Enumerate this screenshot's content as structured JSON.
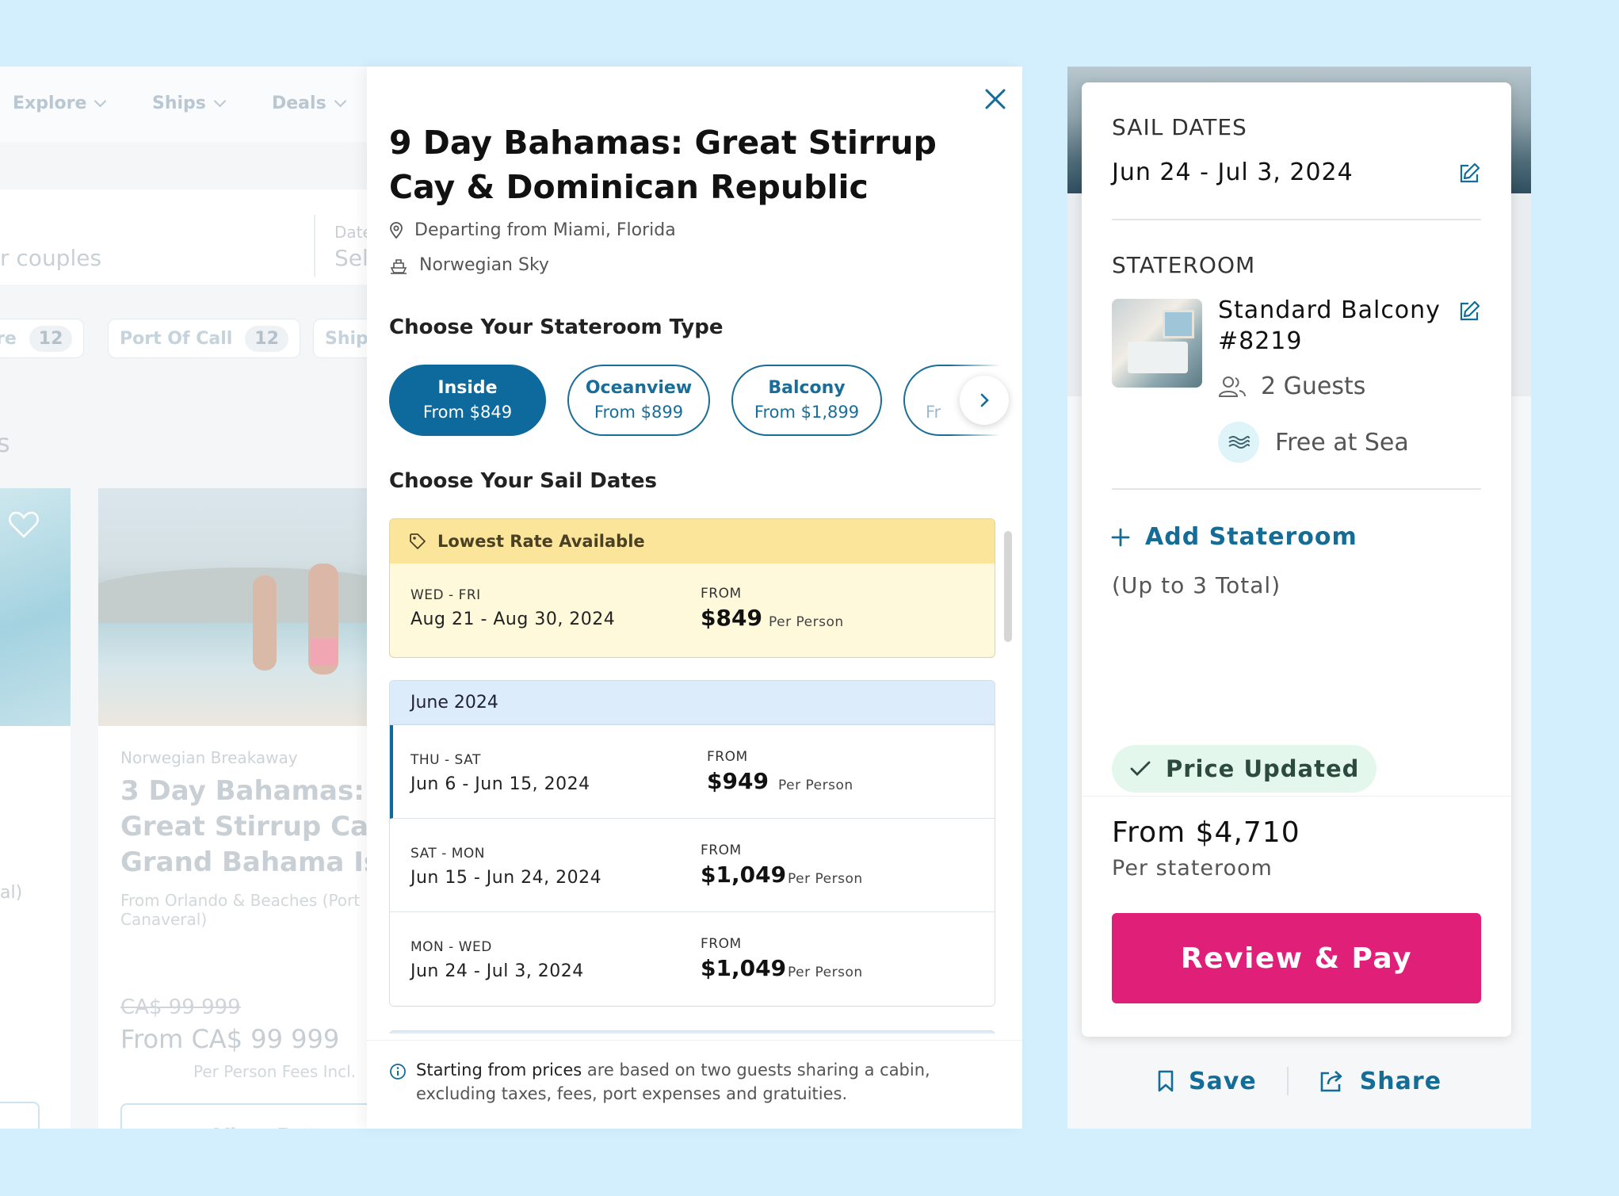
{
  "background_page": {
    "nav": [
      "Explore",
      "Ships",
      "Deals"
    ],
    "search_placeholder": "r couples",
    "date_label": "Date",
    "date_value": "Sel",
    "filters": [
      {
        "label": "re",
        "count": "12"
      },
      {
        "label": "Port Of Call",
        "count": "12"
      },
      {
        "label": "Ship",
        "count": ""
      }
    ],
    "partial_letter": "s",
    "card1_partial_text": "al)",
    "card2": {
      "ship": "Norwegian Breakaway",
      "title": "3 Day Bahamas: Great Stirrup Cay & Grand Bahama Island",
      "from": "From Orlando & Beaches (Port Canaveral)",
      "was_price": "CA$ 99 999",
      "price": "From  CA$ 99 999",
      "per_person": "Per Person Fees Incl.",
      "button": "View Dates"
    }
  },
  "modal": {
    "title": "9 Day Bahamas: Great Stirrup Cay & Dominican Republic",
    "departing": "Departing from Miami, Florida",
    "ship": "Norwegian Sky",
    "stateroom_heading": "Choose Your Stateroom Type",
    "stateroom_types": [
      {
        "name": "Inside",
        "price": "From $849",
        "active": true
      },
      {
        "name": "Oceanview",
        "price": "From $899",
        "active": false
      },
      {
        "name": "Balcony",
        "price": "From $1,899",
        "active": false
      },
      {
        "name": "",
        "price": "Fr",
        "active": false
      }
    ],
    "dates_heading": "Choose Your Sail Dates",
    "lowest_rate": {
      "label": "Lowest Rate Available",
      "days": "WED - FRI",
      "range": "Aug 21 - Aug 30, 2024",
      "from_label": "FROM",
      "price": "$849",
      "per": "Per Person"
    },
    "month": "June 2024",
    "sailings": [
      {
        "days": "THU - SAT",
        "range": "Jun 6 - Jun 15, 2024",
        "from_label": "FROM",
        "price": "$949",
        "per": "Per Person",
        "selected": true
      },
      {
        "days": "SAT - MON",
        "range": "Jun 15 - Jun 24, 2024",
        "from_label": "FROM",
        "price": "$1,049",
        "per": "Per Person",
        "selected": false
      },
      {
        "days": "MON - WED",
        "range": "Jun 24 - Jul 3, 2024",
        "from_label": "FROM",
        "price": "$1,049",
        "per": "Per Person",
        "selected": false
      }
    ],
    "disclaimer_bold": "Starting from prices",
    "disclaimer_rest": " are based on two guests sharing a cabin, excluding taxes, fees, port expenses and gratuities."
  },
  "summary": {
    "sail_dates_label": "SAIL DATES",
    "sail_dates_value": "Jun 24 - Jul 3, 2024",
    "stateroom_label": "STATEROOM",
    "room_line1": "Standard Balcony",
    "room_line2": "#8219",
    "guests": "2 Guests",
    "perk": "Free at Sea",
    "add_stateroom": "Add Stateroom",
    "add_limit": "(Up to 3 Total)",
    "badge": "Price Updated",
    "from_price": "From $4,710",
    "per_stateroom": "Per stateroom",
    "review_button": "Review & Pay",
    "save": "Save",
    "share": "Share"
  },
  "colors": {
    "page_bg": "#d3effd",
    "brand_blue": "#0e6a9c",
    "action_blue": "#136d97",
    "pay_pink": "#df1f78",
    "lowest_rate_yellow": "#fbe59a",
    "month_header_blue": "#dcecfa",
    "badge_green": "#e3f7ec"
  },
  "icons": [
    "chevron-down-icon",
    "heart-icon",
    "close-icon",
    "location-pin-icon",
    "ship-icon",
    "chevron-right-icon",
    "tag-icon",
    "info-icon",
    "edit-icon",
    "guests-icon",
    "waves-icon",
    "plus-icon",
    "check-icon",
    "bookmark-icon",
    "share-icon"
  ]
}
